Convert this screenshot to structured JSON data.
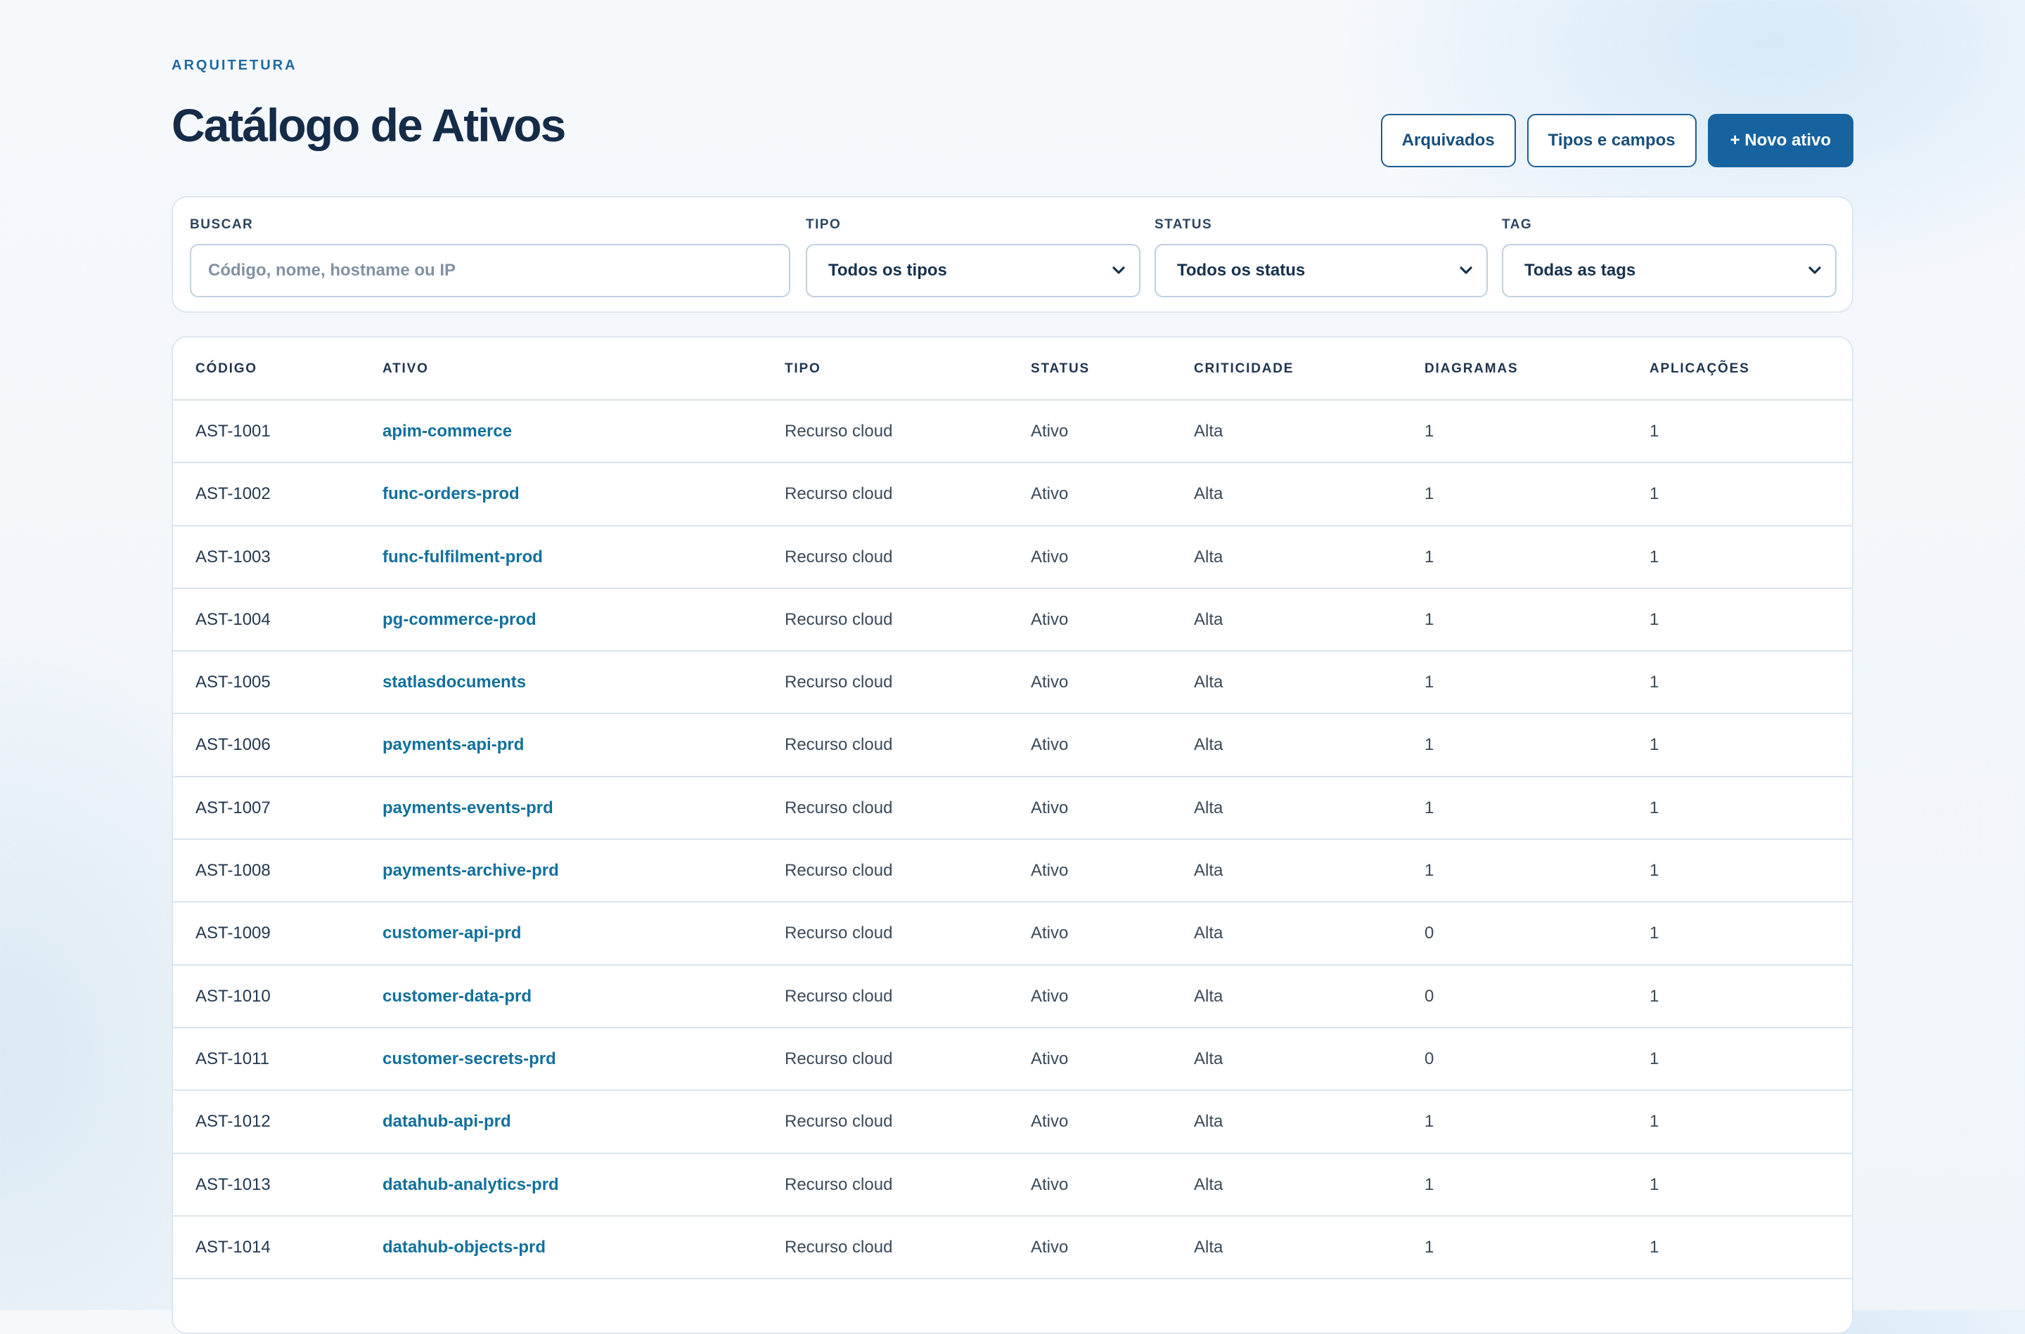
{
  "header": {
    "eyebrow": "ARQUITETURA",
    "title": "Catálogo de Ativos"
  },
  "actions": {
    "archived": "Arquivados",
    "types_fields": "Tipos e campos",
    "new_asset": "+ Novo ativo"
  },
  "filters": {
    "search": {
      "label": "BUSCAR",
      "placeholder": "Código, nome, hostname ou IP",
      "value": ""
    },
    "type": {
      "label": "TIPO",
      "selected": "Todos os tipos"
    },
    "status": {
      "label": "STATUS",
      "selected": "Todos os status"
    },
    "tag": {
      "label": "TAG",
      "selected": "Todas as tags"
    }
  },
  "table": {
    "columns": [
      "CÓDIGO",
      "ATIVO",
      "TIPO",
      "STATUS",
      "CRITICIDADE",
      "DIAGRAMAS",
      "APLICAÇÕES"
    ],
    "rows": [
      {
        "code": "AST-1001",
        "name": "apim-commerce",
        "type": "Recurso cloud",
        "status": "Ativo",
        "criticality": "Alta",
        "diagrams": "1",
        "applications": "1"
      },
      {
        "code": "AST-1002",
        "name": "func-orders-prod",
        "type": "Recurso cloud",
        "status": "Ativo",
        "criticality": "Alta",
        "diagrams": "1",
        "applications": "1"
      },
      {
        "code": "AST-1003",
        "name": "func-fulfilment-prod",
        "type": "Recurso cloud",
        "status": "Ativo",
        "criticality": "Alta",
        "diagrams": "1",
        "applications": "1"
      },
      {
        "code": "AST-1004",
        "name": "pg-commerce-prod",
        "type": "Recurso cloud",
        "status": "Ativo",
        "criticality": "Alta",
        "diagrams": "1",
        "applications": "1"
      },
      {
        "code": "AST-1005",
        "name": "statlasdocuments",
        "type": "Recurso cloud",
        "status": "Ativo",
        "criticality": "Alta",
        "diagrams": "1",
        "applications": "1"
      },
      {
        "code": "AST-1006",
        "name": "payments-api-prd",
        "type": "Recurso cloud",
        "status": "Ativo",
        "criticality": "Alta",
        "diagrams": "1",
        "applications": "1"
      },
      {
        "code": "AST-1007",
        "name": "payments-events-prd",
        "type": "Recurso cloud",
        "status": "Ativo",
        "criticality": "Alta",
        "diagrams": "1",
        "applications": "1"
      },
      {
        "code": "AST-1008",
        "name": "payments-archive-prd",
        "type": "Recurso cloud",
        "status": "Ativo",
        "criticality": "Alta",
        "diagrams": "1",
        "applications": "1"
      },
      {
        "code": "AST-1009",
        "name": "customer-api-prd",
        "type": "Recurso cloud",
        "status": "Ativo",
        "criticality": "Alta",
        "diagrams": "0",
        "applications": "1"
      },
      {
        "code": "AST-1010",
        "name": "customer-data-prd",
        "type": "Recurso cloud",
        "status": "Ativo",
        "criticality": "Alta",
        "diagrams": "0",
        "applications": "1"
      },
      {
        "code": "AST-1011",
        "name": "customer-secrets-prd",
        "type": "Recurso cloud",
        "status": "Ativo",
        "criticality": "Alta",
        "diagrams": "0",
        "applications": "1"
      },
      {
        "code": "AST-1012",
        "name": "datahub-api-prd",
        "type": "Recurso cloud",
        "status": "Ativo",
        "criticality": "Alta",
        "diagrams": "1",
        "applications": "1"
      },
      {
        "code": "AST-1013",
        "name": "datahub-analytics-prd",
        "type": "Recurso cloud",
        "status": "Ativo",
        "criticality": "Alta",
        "diagrams": "1",
        "applications": "1"
      },
      {
        "code": "AST-1014",
        "name": "datahub-objects-prd",
        "type": "Recurso cloud",
        "status": "Ativo",
        "criticality": "Alta",
        "diagrams": "1",
        "applications": "1"
      }
    ]
  },
  "icons": {
    "select_chevron": "chevron-down-icon"
  }
}
